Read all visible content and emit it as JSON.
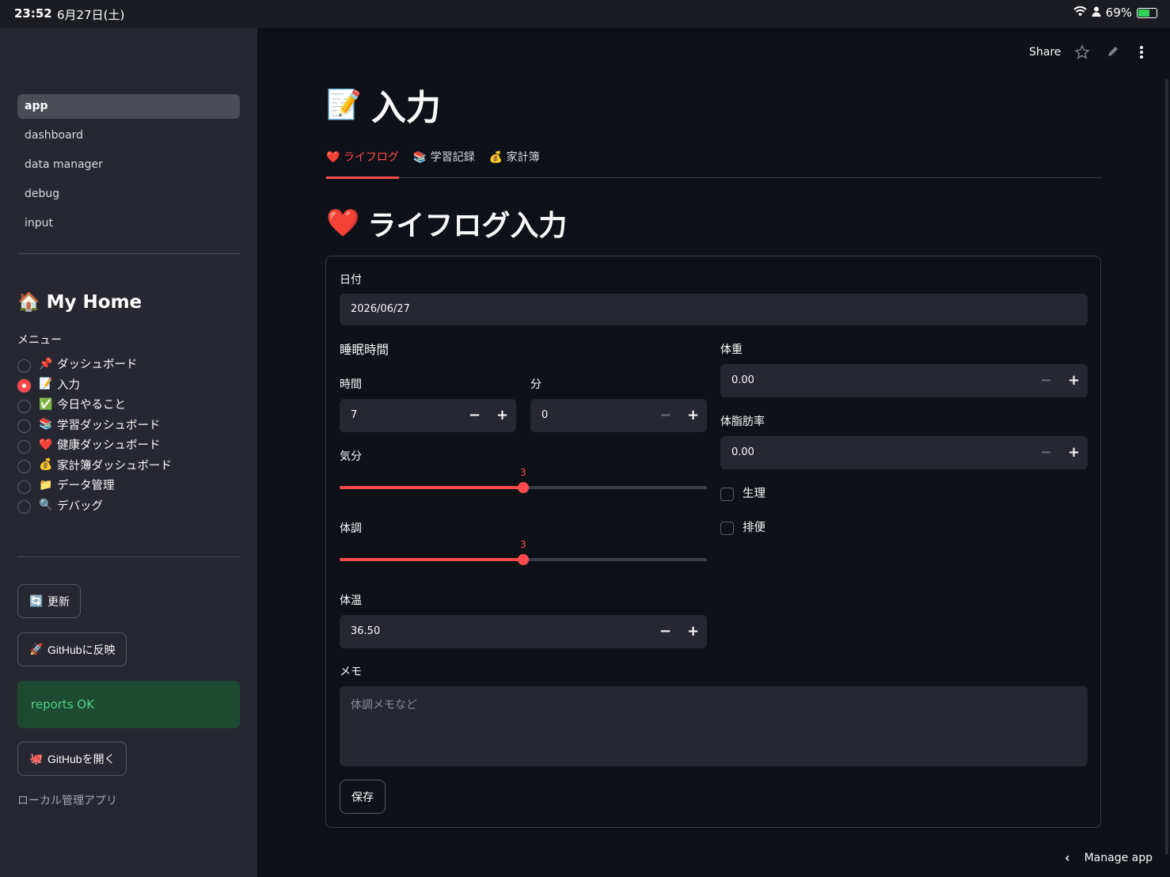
{
  "status_bar": {
    "time": "23:52",
    "date": "6月27日(土)",
    "battery": "69%",
    "battery_fraction": 0.69
  },
  "sidebar": {
    "nav": [
      {
        "label": "app",
        "active": true
      },
      {
        "label": "dashboard",
        "active": false
      },
      {
        "label": "data manager",
        "active": false
      },
      {
        "label": "debug",
        "active": false
      },
      {
        "label": "input",
        "active": false
      }
    ],
    "home_emoji": "🏠",
    "home_title": "My Home",
    "menu_label": "メニュー",
    "menu": [
      {
        "emoji": "📌",
        "label": "ダッシュボード",
        "checked": false
      },
      {
        "emoji": "📝",
        "label": "入力",
        "checked": true
      },
      {
        "emoji": "✅",
        "label": "今日やること",
        "checked": false
      },
      {
        "emoji": "📚",
        "label": "学習ダッシュボード",
        "checked": false
      },
      {
        "emoji": "❤️",
        "label": "健康ダッシュボード",
        "checked": false
      },
      {
        "emoji": "💰",
        "label": "家計簿ダッシュボード",
        "checked": false
      },
      {
        "emoji": "📁",
        "label": "データ管理",
        "checked": false
      },
      {
        "emoji": "🔍",
        "label": "デバッグ",
        "checked": false
      }
    ],
    "refresh_emoji": "🔄",
    "refresh_label": "更新",
    "push_emoji": "🚀",
    "push_label": "GitHubに反映",
    "status_message": "reports OK",
    "open_emoji": "🐙",
    "open_label": "GitHubを開く",
    "caption": "ローカル管理アプリ"
  },
  "header": {
    "share_label": "Share"
  },
  "main": {
    "title_emoji": "📝",
    "title": "入力",
    "tabs": [
      {
        "emoji": "❤️",
        "label": "ライフログ",
        "active": true
      },
      {
        "emoji": "📚",
        "label": "学習記録",
        "active": false
      },
      {
        "emoji": "💰",
        "label": "家計簿",
        "active": false
      }
    ],
    "section_emoji": "❤️",
    "section_title": "ライフログ入力",
    "form": {
      "date_label": "日付",
      "date_value": "2026/06/27",
      "sleep_label": "睡眠時間",
      "hours_label": "時間",
      "hours_value": "7",
      "minutes_label": "分",
      "minutes_value": "0",
      "mood_label": "気分",
      "mood_value": "3",
      "mood_min": 1,
      "mood_max": 5,
      "condition_label": "体調",
      "condition_value": "3",
      "condition_min": 1,
      "condition_max": 5,
      "temp_label": "体温",
      "temp_value": "36.50",
      "weight_label": "体重",
      "weight_value": "0.00",
      "bodyfat_label": "体脂肪率",
      "bodyfat_value": "0.00",
      "period_label": "生理",
      "bowel_label": "排便",
      "memo_label": "メモ",
      "memo_placeholder": "体調メモなど",
      "save_label": "保存"
    }
  },
  "footer": {
    "manage_label": "Manage app"
  }
}
